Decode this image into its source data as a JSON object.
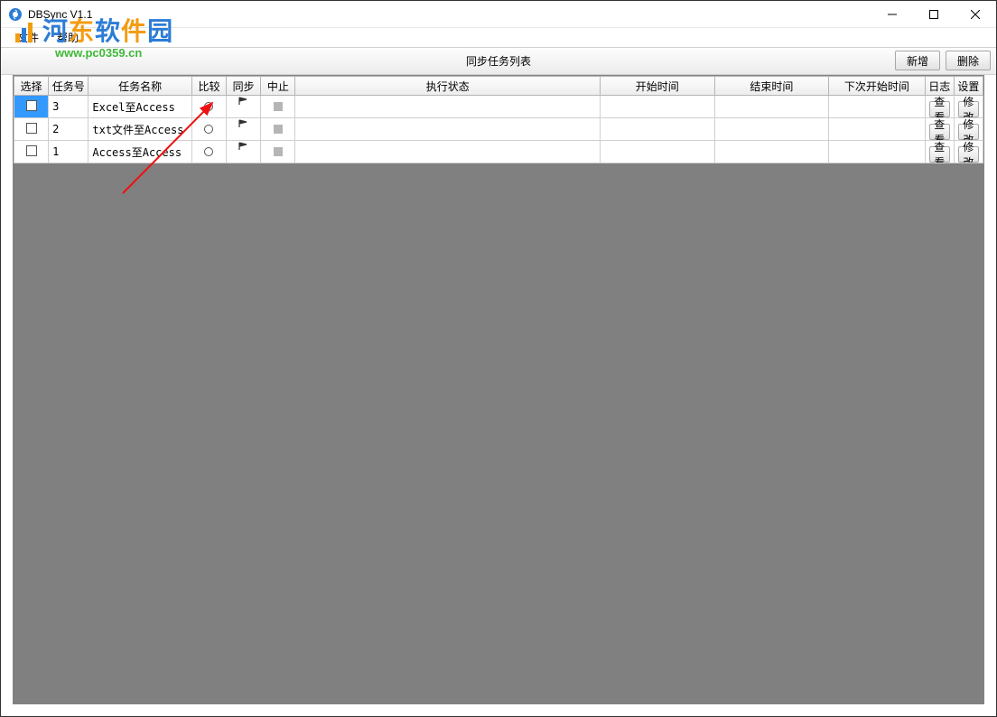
{
  "window": {
    "title": "DBSync V1.1"
  },
  "menu": {
    "file": "文件",
    "help": "帮助"
  },
  "watermark": {
    "text": "河东软件园",
    "url": "www.pc0359.cn"
  },
  "toolbar": {
    "title": "同步任务列表",
    "add": "新增",
    "delete": "删除"
  },
  "columns": {
    "select": "选择",
    "taskno": "任务号",
    "name": "任务名称",
    "compare": "比较",
    "sync": "同步",
    "stop": "中止",
    "status": "执行状态",
    "start": "开始时间",
    "end": "结束时间",
    "next": "下次开始时间",
    "log": "日志",
    "settings": "设置"
  },
  "buttons": {
    "view": "查看",
    "modify": "修改"
  },
  "rows": [
    {
      "selected": true,
      "taskno": "3",
      "name": "Excel至Access",
      "status": "",
      "start": "",
      "end": "",
      "next": ""
    },
    {
      "selected": false,
      "taskno": "2",
      "name": "txt文件至Access",
      "status": "",
      "start": "",
      "end": "",
      "next": ""
    },
    {
      "selected": false,
      "taskno": "1",
      "name": "Access至Access",
      "status": "",
      "start": "",
      "end": "",
      "next": ""
    }
  ]
}
